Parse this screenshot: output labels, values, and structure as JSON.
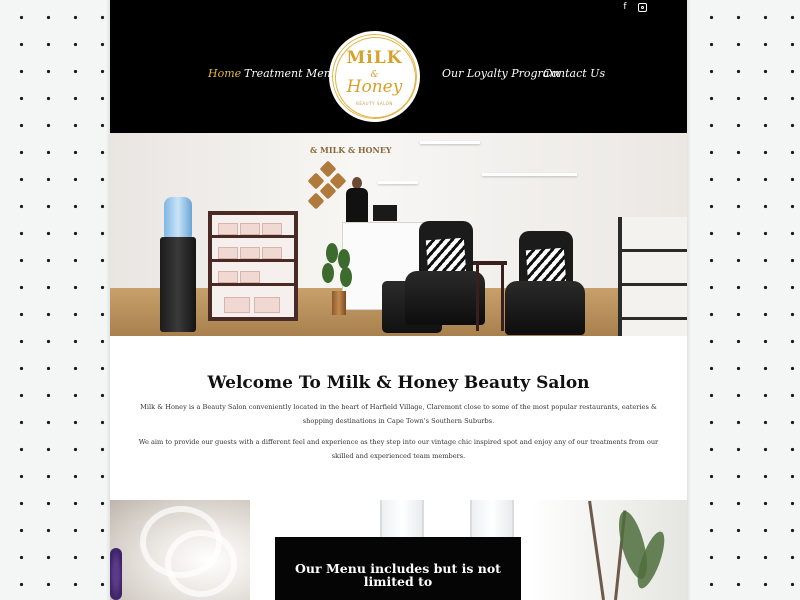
{
  "header": {
    "social": {
      "facebook": "f",
      "instagram": "instagram"
    },
    "nav": {
      "home": "Home",
      "treatment_menu": "Treatment Menu",
      "loyalty_program": "Our Loyalty Program",
      "contact_us": "Contact Us"
    },
    "logo": {
      "line1": "MiLK",
      "ampersand": "&",
      "line2": "Honey",
      "tagline": "BEAUTY SALON"
    }
  },
  "hero": {
    "wall_sign": "& MILK & HONEY"
  },
  "welcome": {
    "title": "Welcome To Milk & Honey Beauty Salon",
    "paragraph1": "Milk & Honey is a Beauty Salon conveniently located in the heart of Harfield Village, Claremont close to some of the most popular restaurants, eateries & shopping destinations in Cape Town's Southern Suburbs.",
    "paragraph2": "We aim to provide our guests with a different feel and experience as they step into our vintage chic inspired spot and enjoy any of our treatments from our skilled and experienced team members."
  },
  "menu_section": {
    "heading": "Our Menu includes but is not limited to"
  },
  "colors": {
    "header_bg": "#000000",
    "accent_gold": "#e5b93a",
    "page_bg": "#ffffff",
    "pattern_bg": "#f4f6f6"
  }
}
